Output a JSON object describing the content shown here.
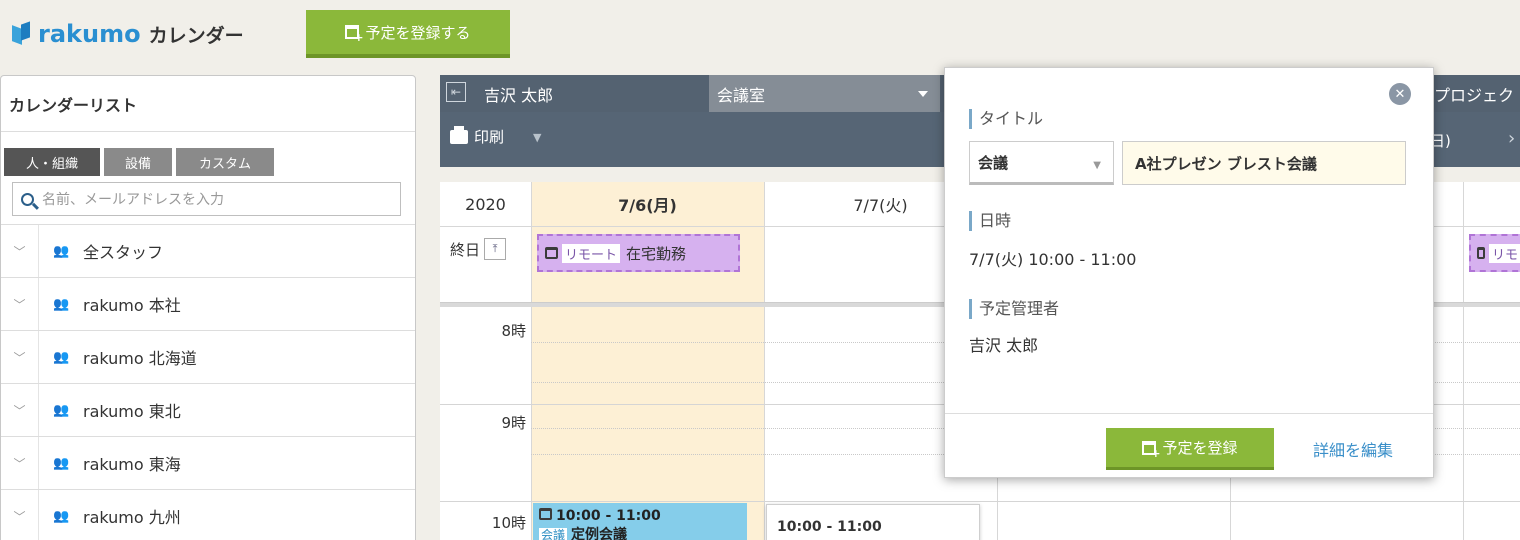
{
  "header": {
    "logo_text": "rakumo",
    "logo_sub": "カレンダー",
    "add_event_button": "予定を登録する"
  },
  "sidebar": {
    "title": "カレンダーリスト",
    "tabs": [
      "人・組織",
      "設備",
      "カスタム"
    ],
    "search_placeholder": "名前、メールアドレスを入力",
    "groups": [
      "全スタッフ",
      "rakumo 本社",
      "rakumo 北海道",
      "rakumo 東北",
      "rakumo 東海",
      "rakumo 九州"
    ]
  },
  "calendar": {
    "user_selector": "吉沢 太郎",
    "room_selector": "会議室",
    "project_selector": "プロジェク",
    "print_label": "印刷",
    "week_right_fragment": "日)",
    "year": "2020",
    "days": [
      "7/6(月)",
      "7/7(火)"
    ],
    "allday_label": "終日",
    "hours": [
      "8時",
      "9時",
      "10時"
    ],
    "remote_event": {
      "tag": "リモート",
      "title": "在宅勤務",
      "tag_fragment": "リモ"
    },
    "event_mon": {
      "time": "10:00 - 11:00",
      "tag": "会議",
      "title": "定例会議"
    },
    "event_tue": {
      "time": "10:00 - 11:00"
    }
  },
  "popup": {
    "title_label": "タイトル",
    "category_value": "会議",
    "title_value": "A社プレゼン ブレスト会議",
    "datetime_label": "日時",
    "datetime_value": "7/7(火) 10:00 - 11:00",
    "organizer_label": "予定管理者",
    "organizer_value": "吉沢 太郎",
    "save_button": "予定を登録",
    "edit_link": "詳細を編集"
  },
  "colors": {
    "brand_blue": "#2a8fd1",
    "green_button": "#8bb83a",
    "today_bg": "#fdf0d5",
    "remote_event": "#d6b1ef",
    "meeting_event": "#85cdea"
  }
}
